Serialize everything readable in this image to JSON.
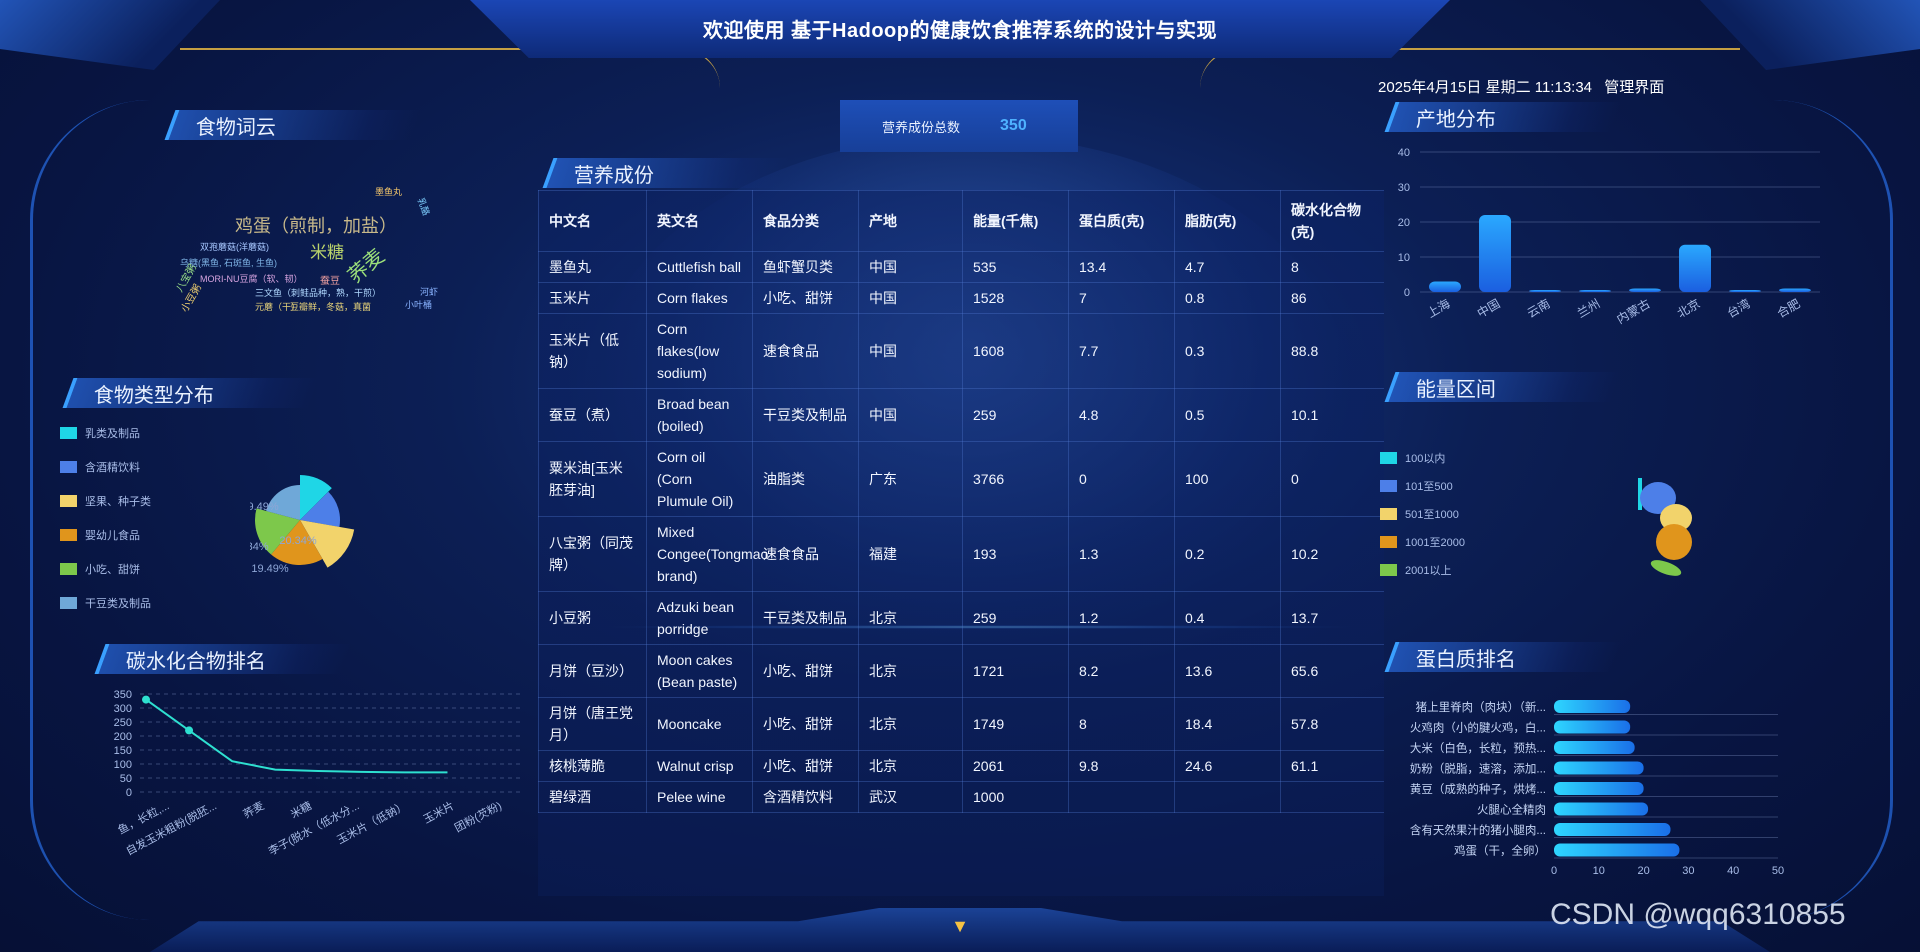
{
  "header": {
    "title": "欢迎使用 基于Hadoop的健康饮食推荐系统的设计与实现",
    "datetime": "2025年4月15日 星期二 11:13:34",
    "admin_link": "管理界面"
  },
  "panels": {
    "wordcloud_title": "食物词云",
    "food_type_title": "食物类型分布",
    "carb_rank_title": "碳水化合物排名",
    "nutrition_title": "营养成份",
    "origin_title": "产地分布",
    "energy_title": "能量区间",
    "protein_title": "蛋白质排名"
  },
  "counter": {
    "label": "营养成份总数",
    "value": "350"
  },
  "wordcloud": [
    {
      "text": "鸡蛋（煎制，加盐）",
      "color": "#c8b98a"
    },
    {
      "text": "米糖",
      "color": "#b9d36b"
    },
    {
      "text": "荞麦",
      "color": "#9ce07a"
    },
    {
      "text": "双孢蘑菇(洋蘑菇)",
      "color": "#a7c7ff"
    },
    {
      "text": "乌糖(黑鱼, 石斑鱼, 生鱼)",
      "color": "#7fb4e6"
    },
    {
      "text": "MORI-NU豆腐（软、韧）",
      "color": "#d7a4e0"
    },
    {
      "text": "三文鱼（刺鲑品种，熟，干煎）",
      "color": "#b0d8ff"
    },
    {
      "text": "元蘑（干）",
      "color": "#e6d27a"
    },
    {
      "text": "豆瓣鲜，冬菇，真菌",
      "color": "#e6d27a"
    },
    {
      "text": "小叶桶",
      "color": "#8ab3ff"
    },
    {
      "text": "八宝粥",
      "color": "#9de38a"
    },
    {
      "text": "小豆粥",
      "color": "#f0d070"
    },
    {
      "text": "蚕豆",
      "color": "#f0a0a0"
    },
    {
      "text": "乳酪",
      "color": "#7fd0ff"
    },
    {
      "text": "墨鱼丸",
      "color": "#f5c76a"
    },
    {
      "text": "河虾",
      "color": "#8ab3ff"
    }
  ],
  "food_type": {
    "legend": [
      {
        "label": "乳类及制品",
        "color": "#1fd6e6"
      },
      {
        "label": "含酒精饮料",
        "color": "#4d7fe8"
      },
      {
        "label": "坚果、种子类",
        "color": "#f2d36b"
      },
      {
        "label": "婴幼儿食品",
        "color": "#e0951c"
      },
      {
        "label": "小吃、甜饼",
        "color": "#7dc84b"
      },
      {
        "label": "干豆类及制品",
        "color": "#6fa8d8"
      }
    ],
    "labels": [
      "19.49%",
      "20.34%",
      "19.49%",
      "20.34%"
    ]
  },
  "carb_rank": {
    "y_ticks": [
      "350",
      "300",
      "250",
      "200",
      "150",
      "100",
      "50",
      "0"
    ],
    "x_labels": [
      "鱼，长粒,...",
      "自发玉米粗粉(脱胚...",
      "荞麦",
      "米糖",
      "李子(脱水（低水分...",
      "玉米片（低钠）",
      "玉米片",
      "团粉(芡粉)"
    ],
    "values": [
      330,
      220,
      110,
      80,
      75,
      72,
      70,
      70
    ]
  },
  "nutrition_table": {
    "headers": [
      "中文名",
      "英文名",
      "食品分类",
      "产地",
      "能量(千焦)",
      "蛋白质(克)",
      "脂肪(克)",
      "碳水化合物(克)"
    ],
    "rows": [
      [
        "墨鱼丸",
        "Cuttlefish ball",
        "鱼虾蟹贝类",
        "中国",
        "535",
        "13.4",
        "4.7",
        "8"
      ],
      [
        "玉米片",
        "Corn flakes",
        "小吃、甜饼",
        "中国",
        "1528",
        "7",
        "0.8",
        "86"
      ],
      [
        "玉米片（低钠）",
        "Corn flakes(low sodium)",
        "速食食品",
        "中国",
        "1608",
        "7.7",
        "0.3",
        "88.8"
      ],
      [
        "蚕豆（煮）",
        "Broad bean (boiled)",
        "干豆类及制品",
        "中国",
        "259",
        "4.8",
        "0.5",
        "10.1"
      ],
      [
        "粟米油[玉米胚芽油]",
        "Corn oil (Corn Plumule Oil)",
        "油脂类",
        "广东",
        "3766",
        "0",
        "100",
        "0"
      ],
      [
        "八宝粥（同茂牌）",
        "Mixed Congee(Tongmao brand)",
        "速食食品",
        "福建",
        "193",
        "1.3",
        "0.2",
        "10.2"
      ],
      [
        "小豆粥",
        "Adzuki bean porridge",
        "干豆类及制品",
        "北京",
        "259",
        "1.2",
        "0.4",
        "13.7"
      ],
      [
        "月饼（豆沙）",
        "Moon cakes (Bean paste)",
        "小吃、甜饼",
        "北京",
        "1721",
        "8.2",
        "13.6",
        "65.6"
      ],
      [
        "月饼（唐王党月）",
        "Mooncake",
        "小吃、甜饼",
        "北京",
        "1749",
        "8",
        "18.4",
        "57.8"
      ],
      [
        "核桃薄脆",
        "Walnut crisp",
        "小吃、甜饼",
        "北京",
        "2061",
        "9.8",
        "24.6",
        "61.1"
      ],
      [
        "碧绿酒",
        "Pelee wine",
        "含酒精饮料",
        "武汉",
        "1000",
        "",
        "",
        ""
      ]
    ]
  },
  "chart_data": [
    {
      "type": "bar",
      "title": "产地分布",
      "categories": [
        "上海",
        "中国",
        "云南",
        "兰州",
        "内蒙古",
        "北京",
        "台湾",
        "合肥"
      ],
      "values": [
        3,
        22,
        0.3,
        0.3,
        1,
        13.5,
        0.3,
        1
      ],
      "ylim": [
        0,
        40
      ],
      "y_ticks": [
        "40",
        "30",
        "20",
        "10",
        "0"
      ],
      "grid": true
    },
    {
      "type": "pie",
      "title": "能量区间",
      "legend": [
        {
          "label": "100以内",
          "color": "#1fd6e6"
        },
        {
          "label": "101至500",
          "color": "#4d7fe8"
        },
        {
          "label": "501至1000",
          "color": "#f2d36b"
        },
        {
          "label": "1001至2000",
          "color": "#e0951c"
        },
        {
          "label": "2001以上",
          "color": "#7dc84b"
        }
      ]
    },
    {
      "type": "bar",
      "title": "蛋白质排名",
      "orientation": "horizontal",
      "categories": [
        "猪上里脊肉（肉块）（新...",
        "火鸡肉（小的腱火鸡，白...",
        "大米（白色，长粒，预热...",
        "奶粉（脱脂，速溶，添加...",
        "黄豆（成熟的种子，烘烤...",
        "火腿心全精肉",
        "含有天然果汁的猪小腿肉...",
        "鸡蛋（干，全卵）"
      ],
      "values": [
        17,
        17,
        18,
        20,
        20,
        21,
        26,
        28
      ],
      "xlim": [
        0,
        50
      ],
      "x_ticks": [
        "0",
        "10",
        "20",
        "30",
        "40",
        "50"
      ]
    }
  ],
  "watermark": "CSDN @wqq6310855"
}
